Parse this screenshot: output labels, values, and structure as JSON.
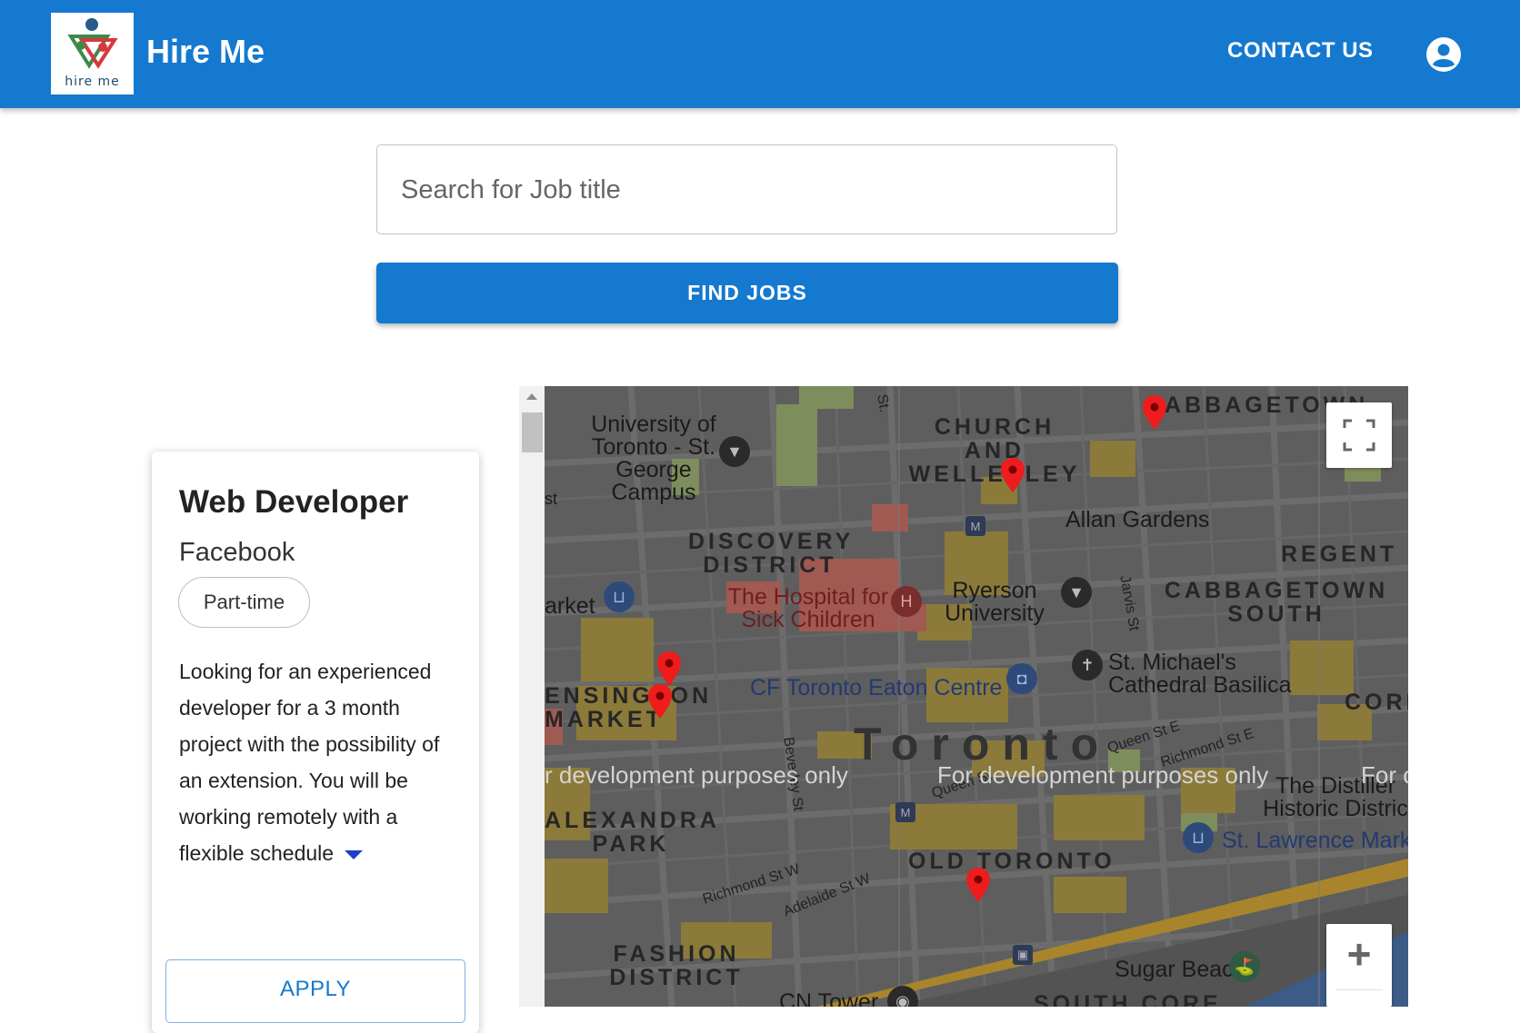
{
  "header": {
    "logo_text": "hire me",
    "title": "Hire Me",
    "contact_label": "CONTACT US",
    "account_icon": "account-circle-icon"
  },
  "search": {
    "placeholder": "Search for Job title",
    "value": "",
    "button_label": "FIND JOBS"
  },
  "job": {
    "title": "Web Developer",
    "company": "Facebook",
    "type": "Part-time",
    "description": "Looking for an experienced developer for a 3 month project with the possibility of an extension. You will be working remotely with a flexible schedule",
    "expand_icon": "caret-down-icon",
    "apply_label": "APPLY"
  },
  "map": {
    "labels": {
      "uoft": "University of Toronto - St. George Campus",
      "church": "CHURCH AND WELLESLEY",
      "cabbagetown": "CABBAGETOWN",
      "allan": "Allan Gardens",
      "discovery": "DISCOVERY DISTRICT",
      "regent": "REGENT",
      "cabb_south": "CABBAGETOWN SOUTH",
      "market": "arket",
      "hospital": "The Hospital for Sick Children",
      "ryerson": "Ryerson University",
      "jarvis": "Jarvis St",
      "kensington": "ENSINGTON MARKET",
      "eaton": "CF Toronto Eaton Centre",
      "stmichael": "St. Michael's Cathedral Basilica",
      "cork": "CORK",
      "toronto": "Toronto",
      "queen_e": "Queen St E",
      "richmond_e": "Richmond St E",
      "beverley": "Beverley St",
      "distillery": "The Distiller Historic Distric",
      "alexandra": "ALEXANDRA PARK",
      "stlawrence": "St. Lawrence Mark",
      "queen": "Queen St",
      "old_toronto": "OLD TORONTO",
      "richmond_w": "Richmond St W",
      "adelaide": "Adelaide St W",
      "fashion": "FASHION DISTRICT",
      "sugar": "Sugar Beach",
      "cn": "CN Tower",
      "south_core": "SOUTH CORE",
      "st": "St.",
      "st_left": "st"
    },
    "watermark": "For development purposes only",
    "watermark_left": "r development purposes only",
    "watermark_right": "For c",
    "fullscreen_icon": "fullscreen-icon",
    "zoom_in_label": "+"
  }
}
